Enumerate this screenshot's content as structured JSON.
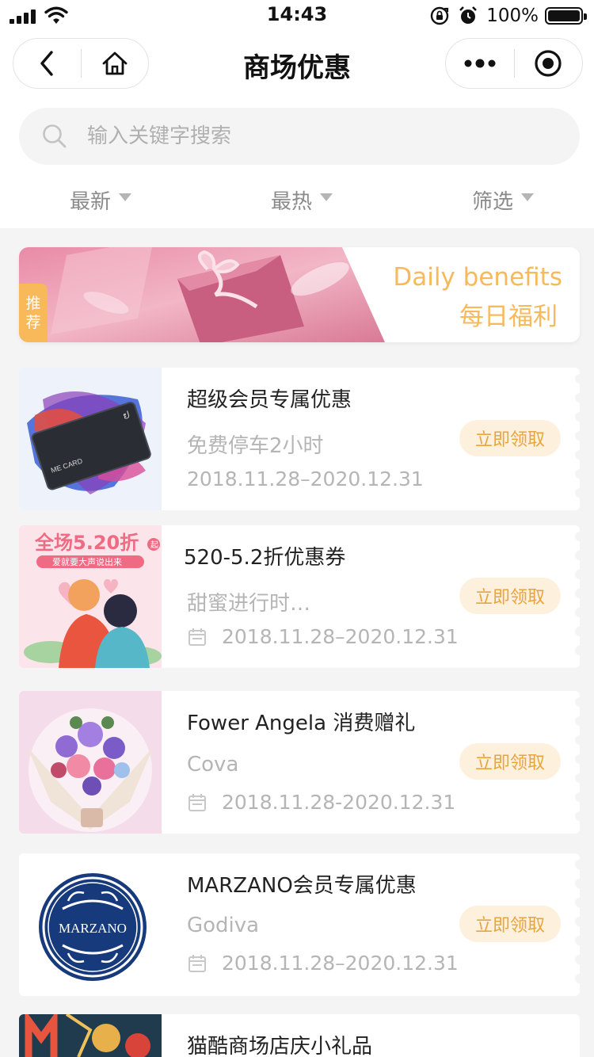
{
  "status_bar": {
    "time": "14:43",
    "battery": "100%"
  },
  "nav": {
    "title": "商场优惠"
  },
  "search": {
    "placeholder": "输入关键字搜索"
  },
  "tabs": [
    {
      "label": "最新"
    },
    {
      "label": "最热"
    },
    {
      "label": "筛选"
    }
  ],
  "banner": {
    "tag": [
      "推",
      "荐"
    ],
    "title_en": "Daily benefits",
    "title_cn": "每日福利"
  },
  "coupons": [
    {
      "title": "超级会员专属优惠",
      "subtitle": "免费停车2小时",
      "date": "2018.11.28–2020.12.31",
      "button": "立即领取",
      "image_text": "ME CARD"
    },
    {
      "title": "520-5.2折优惠券",
      "subtitle": "甜蜜进行时…",
      "date": "2018.11.28–2020.12.31",
      "button": "立即领取",
      "image_text": "全场5.20折",
      "image_text2": "起",
      "image_text3": "爱就要大声说出来"
    },
    {
      "title": "Fower Angela 消费赠礼",
      "subtitle": "Cova",
      "date": "2018.11.28-2020.12.31",
      "button": "立即领取"
    },
    {
      "title": "MARZANO会员专属优惠",
      "subtitle": "Godiva",
      "date": "2018.11.28–2020.12.31",
      "button": "立即领取",
      "image_text": "MARZANO"
    },
    {
      "title": "猫酷商场店庆小礼品"
    }
  ],
  "colors": {
    "accent": "#f7b95a",
    "button_bg": "#fdf1dd",
    "button_text": "#e9a43e",
    "muted": "#b5b5b5"
  }
}
